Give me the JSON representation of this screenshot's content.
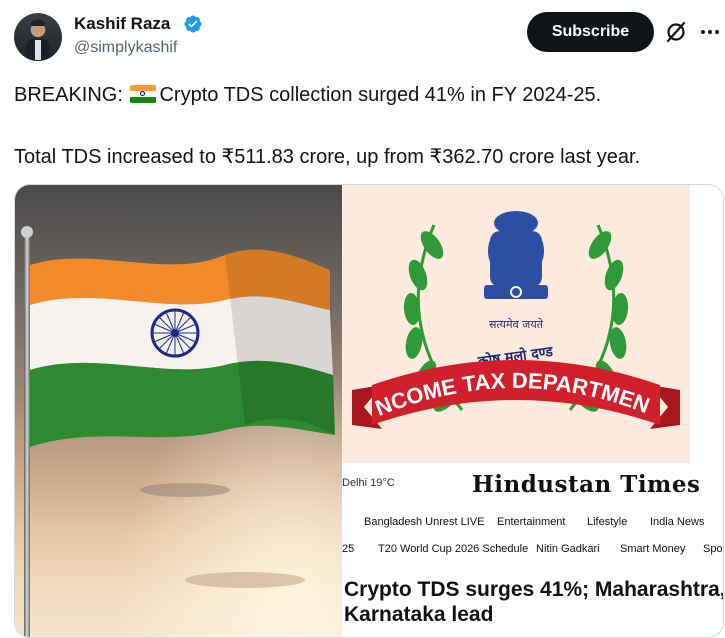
{
  "author": {
    "name": "Kashif Raza",
    "handle": "@simplykashif"
  },
  "actions": {
    "subscribe_label": "Subscribe"
  },
  "tweet": {
    "line1_prefix": "BREAKING: ",
    "line1_suffix": "Crypto TDS collection surged 41% in FY 2024-25.",
    "line2": "Total TDS increased to ₹511.83 crore, up from ₹362.70 crore last year."
  },
  "emblem": {
    "motto": "सत्यमेव जयते",
    "sanskrit": "कोष मूलो दण्ड",
    "department": "INCOME TAX DEPARTMENT"
  },
  "ht": {
    "weather": "Delhi 19°C",
    "logo": "Hindustan Times",
    "nav1": [
      "Bangladesh Unrest LIVE",
      "Entertainment",
      "Lifestyle",
      "India News"
    ],
    "nav2": [
      "25",
      "T20 World Cup 2026 Schedule",
      "Nitin Gadkari",
      "Smart Money",
      "Spo"
    ],
    "headline_l1": "Crypto TDS surges 41%; Maharashtra,",
    "headline_l2": "Karnataka lead"
  },
  "colors": {
    "saffron": "#ff9933",
    "green": "#138808",
    "chakra": "#000080",
    "verified": "#1d9bf0",
    "banner_red": "#d11f2b",
    "wreath_green": "#2f9a3a"
  }
}
